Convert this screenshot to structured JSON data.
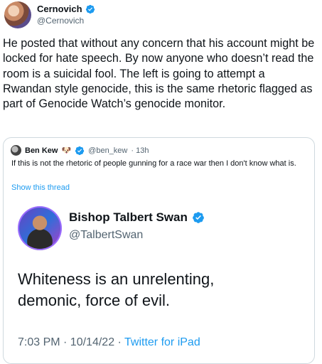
{
  "author": {
    "name": "Cernovich",
    "handle": "@Cernovich",
    "verified": true,
    "avatar_icon": "avatar-photo"
  },
  "tweet": {
    "text": "He posted that without any concern that his account might be locked for hate speech. By now anyone who doesn’t read the room is a suicidal fool. The left is going to attempt a Rwandan style genocide, this is the same rhetoric flagged as part of Genocide Watch’s genocide monitor."
  },
  "quote": {
    "name": "Ben Kew",
    "emoji": "🐶",
    "handle": "@ben_kew",
    "time": "· 13h",
    "verified": true,
    "text": "If this is not the rhetoric of people gunning for a race war then I don't know what is.",
    "show_thread": "Show this thread"
  },
  "embedded": {
    "name": "Bishop Talbert Swan",
    "handle": "@TalbertSwan",
    "verified": true,
    "text_line1": "Whiteness is an unrelenting,",
    "text_line2": "demonic, force of evil.",
    "timestamp": "7:03 PM · 10/14/22 · ",
    "source": "Twitter for iPad"
  },
  "colors": {
    "accent": "#1d9bf0",
    "secondary_text": "#536471",
    "border": "#cfd9de"
  }
}
